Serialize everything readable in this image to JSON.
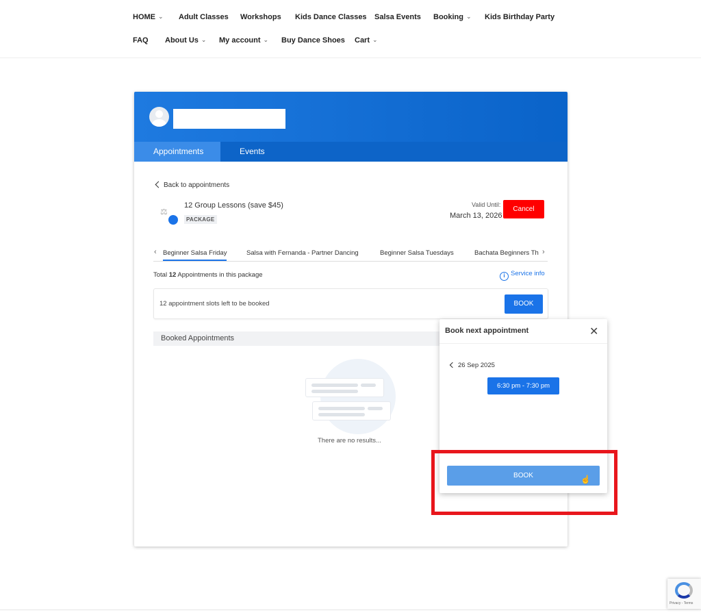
{
  "nav": {
    "home": "HOME",
    "adult_classes": "Adult Classes",
    "workshops": "Workshops",
    "kids_dance": "Kids Dance Classes",
    "salsa_events": "Salsa Events",
    "booking": "Booking",
    "kids_birthday": "Kids Birthday Party",
    "faq": "FAQ",
    "about_us": "About Us",
    "my_account": "My account",
    "buy_shoes": "Buy Dance Shoes",
    "cart": "Cart"
  },
  "header": {
    "tabs": [
      "Appointments",
      "Events"
    ],
    "accent": "#1a73e8"
  },
  "package": {
    "back_label": "Back to appointments",
    "title": "12 Group Lessons (save $45)",
    "badge": "PACKAGE",
    "valid_label": "Valid Until:",
    "valid_date": "March 13, 2026",
    "cancel_label": "Cancel"
  },
  "services": {
    "tabs": [
      "Beginner Salsa Friday",
      "Salsa with Fernanda - Partner Dancing",
      "Beginner Salsa Tuesdays",
      "Bachata Beginners Th"
    ]
  },
  "summary": {
    "total_prefix": "Total ",
    "total_count": "12",
    "total_suffix": " Appointments in this package",
    "service_info": "Service info",
    "slots_left": "12 appointment slots left to be booked",
    "book_label": "BOOK"
  },
  "booked": {
    "heading": "Booked Appointments",
    "empty_text": "There are no results..."
  },
  "popup": {
    "title": "Book next appointment",
    "date": "26 Sep 2025",
    "time_slot": "6:30 pm - 7:30 pm",
    "book_label": "BOOK"
  },
  "recaptcha": {
    "footer": "Privacy - Terms"
  }
}
